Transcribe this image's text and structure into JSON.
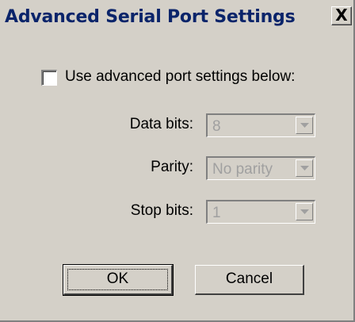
{
  "window": {
    "title": "Advanced Serial Port Settings",
    "close_label": "X"
  },
  "advanced": {
    "checkbox_label": "Use advanced port settings below:",
    "checked": false
  },
  "fields": {
    "data_bits": {
      "label": "Data bits:",
      "value": "8"
    },
    "parity": {
      "label": "Parity:",
      "value": "No parity"
    },
    "stop_bits": {
      "label": "Stop bits:",
      "value": "1"
    }
  },
  "buttons": {
    "ok_label": "OK",
    "cancel_label": "Cancel"
  },
  "colors": {
    "dialog_bg": "#d4d0c8",
    "title_text": "#0a246a",
    "disabled_text": "#a0a0a0"
  }
}
